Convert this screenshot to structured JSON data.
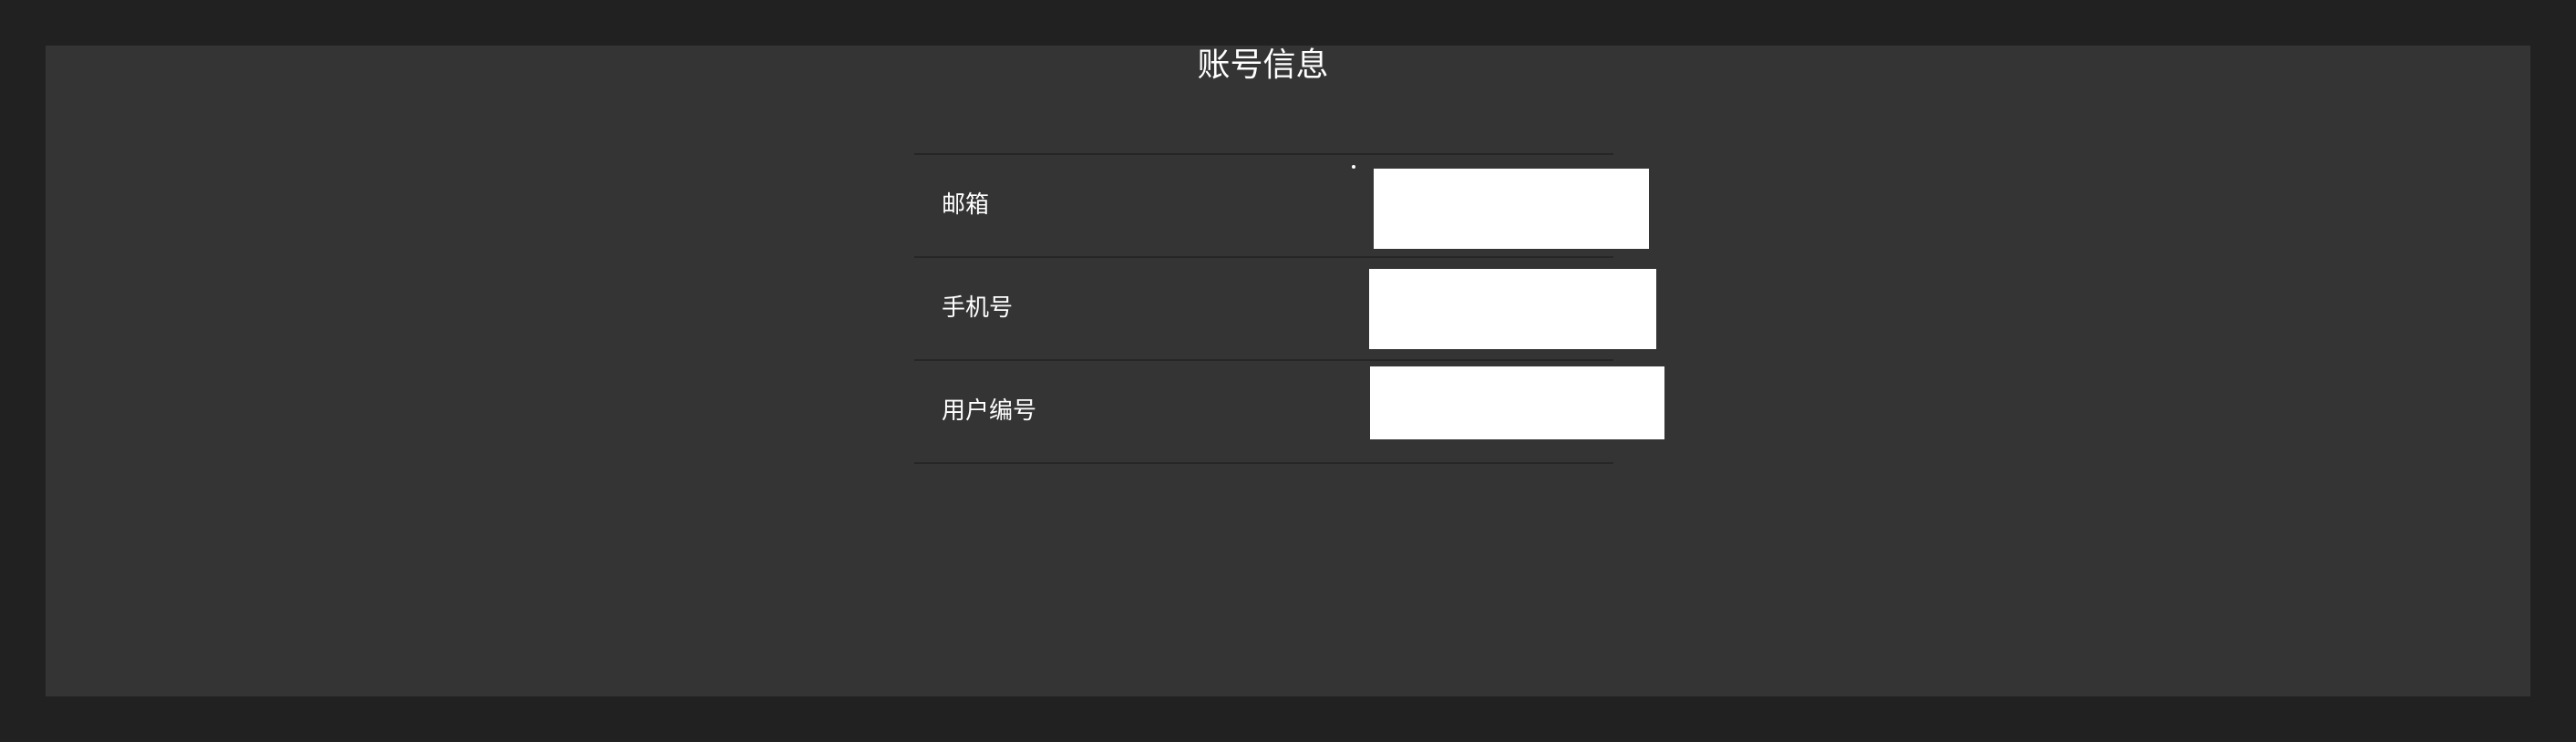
{
  "page": {
    "title": "账号信息"
  },
  "account_info": {
    "rows": [
      {
        "label": "邮箱",
        "value": ""
      },
      {
        "label": "手机号",
        "value": ""
      },
      {
        "label": "用户编号",
        "value": ""
      }
    ]
  },
  "colors": {
    "background": "#212121",
    "panel": "#343434",
    "text": "#ffffff",
    "divider": "#262626",
    "value_box": "#ffffff"
  }
}
